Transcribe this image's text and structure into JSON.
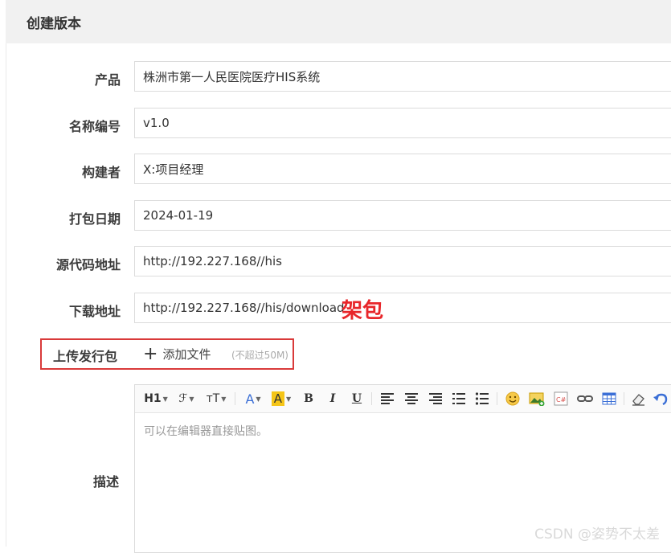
{
  "header": {
    "title": "创建版本"
  },
  "form": {
    "product": {
      "label": "产品",
      "value": "株洲市第一人民医院医疗HIS系统"
    },
    "version_name": {
      "label": "名称编号",
      "value": "v1.0"
    },
    "builder": {
      "label": "构建者",
      "value": "X:项目经理"
    },
    "package_date": {
      "label": "打包日期",
      "value": "2024-01-19"
    },
    "source_url": {
      "label": "源代码地址",
      "value": "http://192.227.168//his"
    },
    "download_url": {
      "label": "下载地址",
      "value": "http://192.227.168//his/download"
    },
    "release_package": {
      "label": "上传发行包",
      "add_file": "添加文件",
      "limit": "(不超过50M)"
    },
    "description": {
      "label": "描述",
      "placeholder": "可以在编辑器直接贴图。"
    }
  },
  "annotation": {
    "text": "架包",
    "color": "#e8262a"
  },
  "editor_toolbar": [
    {
      "name": "heading",
      "text": "H1"
    },
    {
      "name": "font-family",
      "text": "ℱ"
    },
    {
      "name": "font-size",
      "text": "ᴛT"
    },
    {
      "name": "font-color",
      "text": "A"
    },
    {
      "name": "background-color",
      "text": "A"
    },
    {
      "name": "bold",
      "text": "B"
    },
    {
      "name": "italic",
      "text": "I"
    },
    {
      "name": "underline",
      "text": "U"
    }
  ],
  "watermark": "CSDN @姿势不太差"
}
